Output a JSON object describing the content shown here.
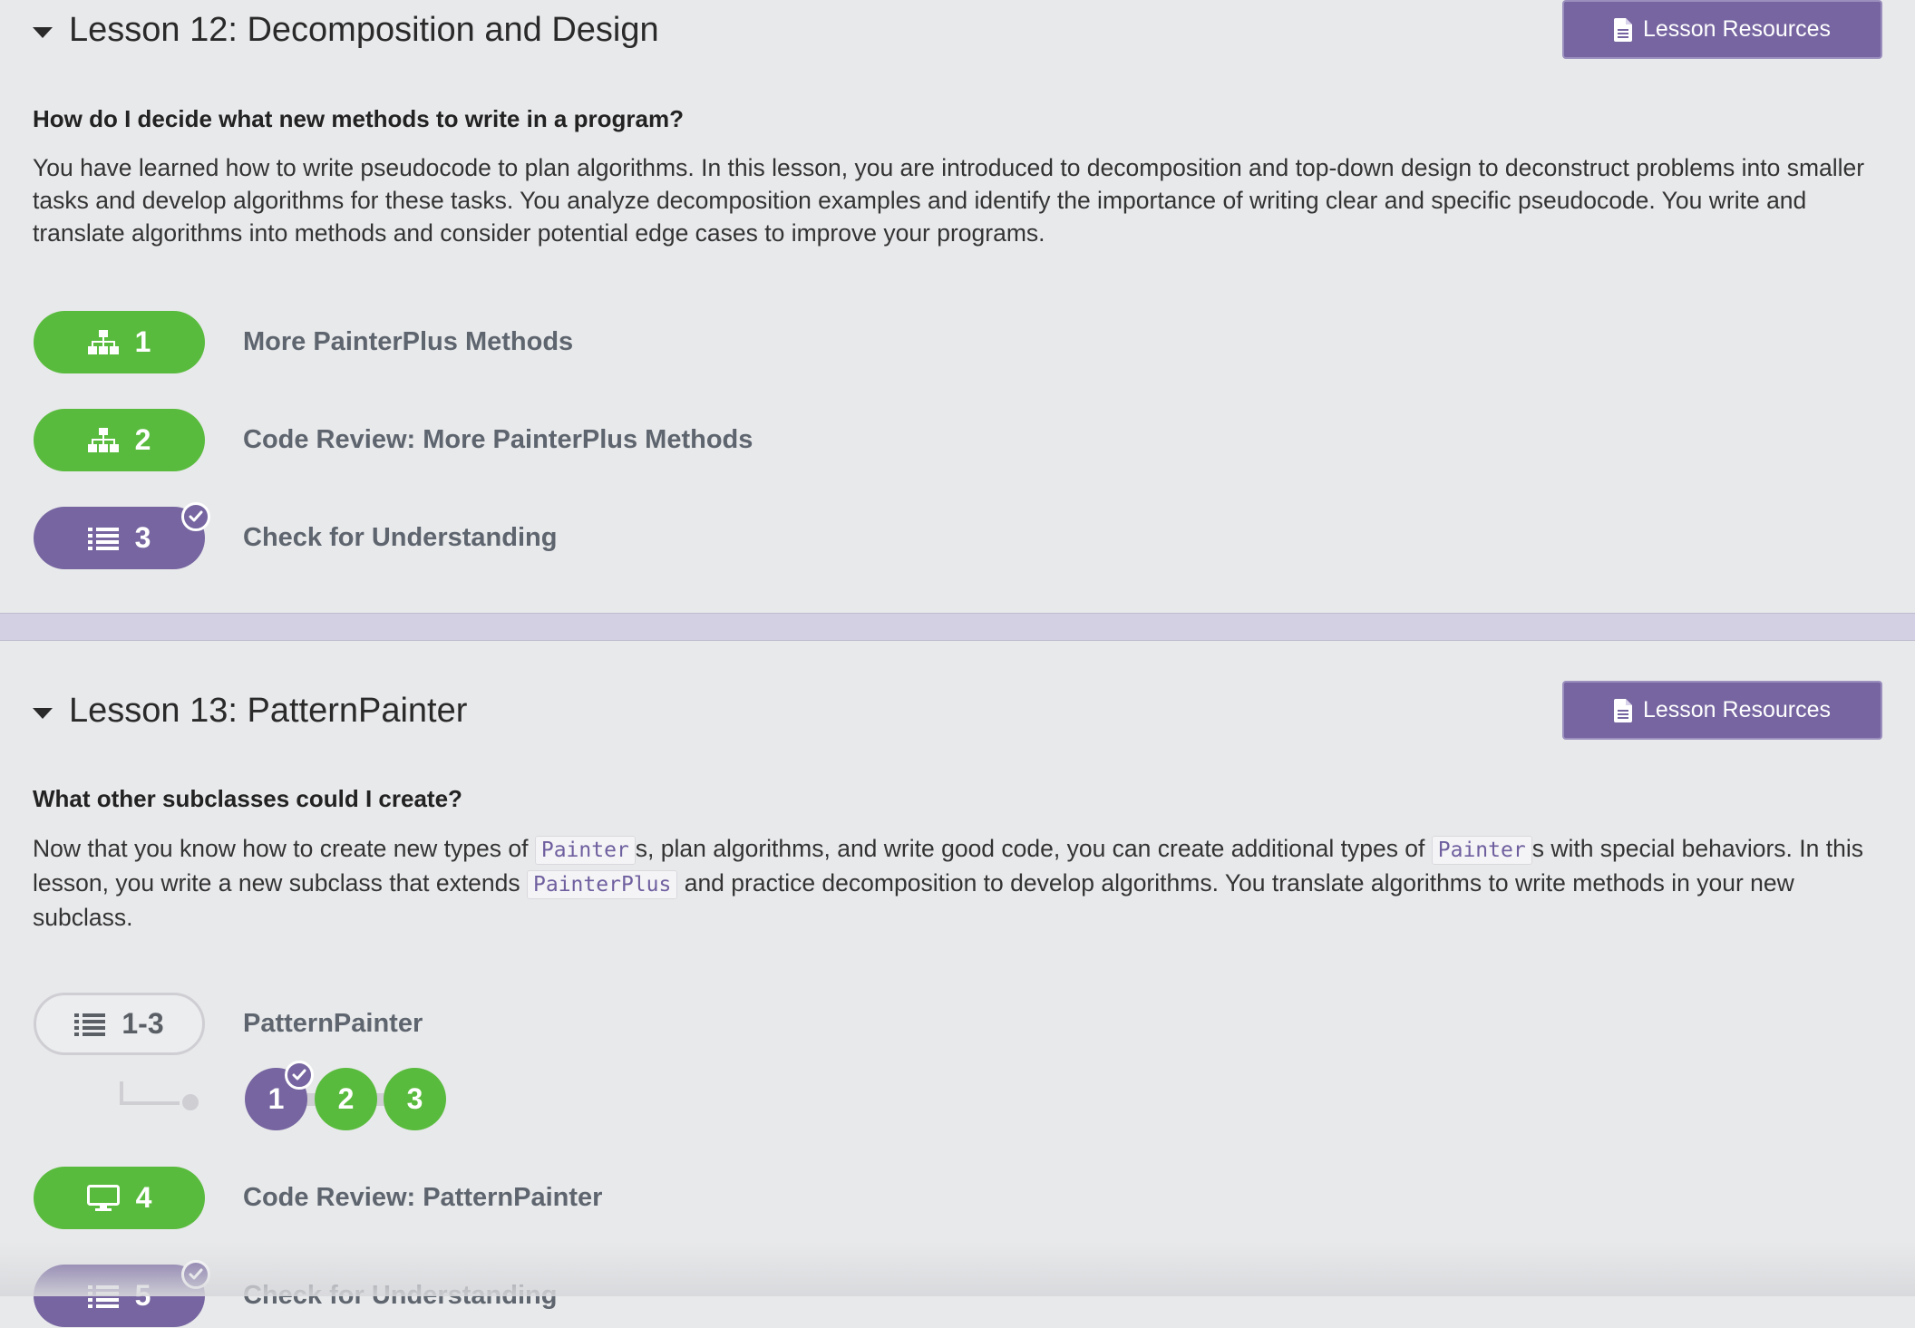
{
  "lessons": [
    {
      "title": "Lesson 12: Decomposition and Design",
      "resources_label": "Lesson Resources",
      "question": "How do I decide what new methods to write in a program?",
      "description": "You have learned how to write pseudocode to plan algorithms. In this lesson, you are introduced to decomposition and top-down design to deconstruct problems into smaller tasks and develop algorithms for these tasks. You analyze decomposition examples and identify the importance of writing clear and specific pseudocode. You write and translate algorithms into methods and consider potential edge cases to improve your programs.",
      "activities": [
        {
          "number": "1",
          "label": "More PainterPlus Methods",
          "icon": "sitemap-icon",
          "color": "green",
          "completed": false
        },
        {
          "number": "2",
          "label": "Code Review: More PainterPlus Methods",
          "icon": "sitemap-icon",
          "color": "green",
          "completed": false
        },
        {
          "number": "3",
          "label": "Check for Understanding",
          "icon": "list-icon",
          "color": "purple",
          "completed": true
        }
      ]
    },
    {
      "title": "Lesson 13: PatternPainter",
      "resources_label": "Lesson Resources",
      "question": "What other subclasses could I create?",
      "description": {
        "t1": "Now that you know how to create new types of ",
        "c1": "Painter",
        "t2": "s, plan algorithms, and write good code, you can create additional types of ",
        "c2": "Painter",
        "t3": "s with special behaviors. In this lesson, you write a new subclass that extends ",
        "c3": "PainterPlus",
        "t4": " and practice decomposition to develop algorithms. You translate algorithms to write methods in your new subclass."
      },
      "activities": [
        {
          "number": "1-3",
          "label": "PatternPainter",
          "icon": "list-icon",
          "color": "outline",
          "completed": false,
          "sublevels": [
            {
              "number": "1",
              "color": "purple",
              "completed": true
            },
            {
              "number": "2",
              "color": "green",
              "completed": false
            },
            {
              "number": "3",
              "color": "green",
              "completed": false
            }
          ]
        },
        {
          "number": "4",
          "label": "Code Review: PatternPainter",
          "icon": "desktop-icon",
          "color": "green",
          "completed": false
        },
        {
          "number": "5",
          "label": "Check for Understanding",
          "icon": "list-icon",
          "color": "purple",
          "completed": true
        }
      ]
    }
  ],
  "colors": {
    "background": "#e8e9eb",
    "accent_purple": "#7665a0",
    "progress_green": "#59bb3d",
    "divider": "#d3d0e3",
    "label_gray": "#5e656e"
  }
}
